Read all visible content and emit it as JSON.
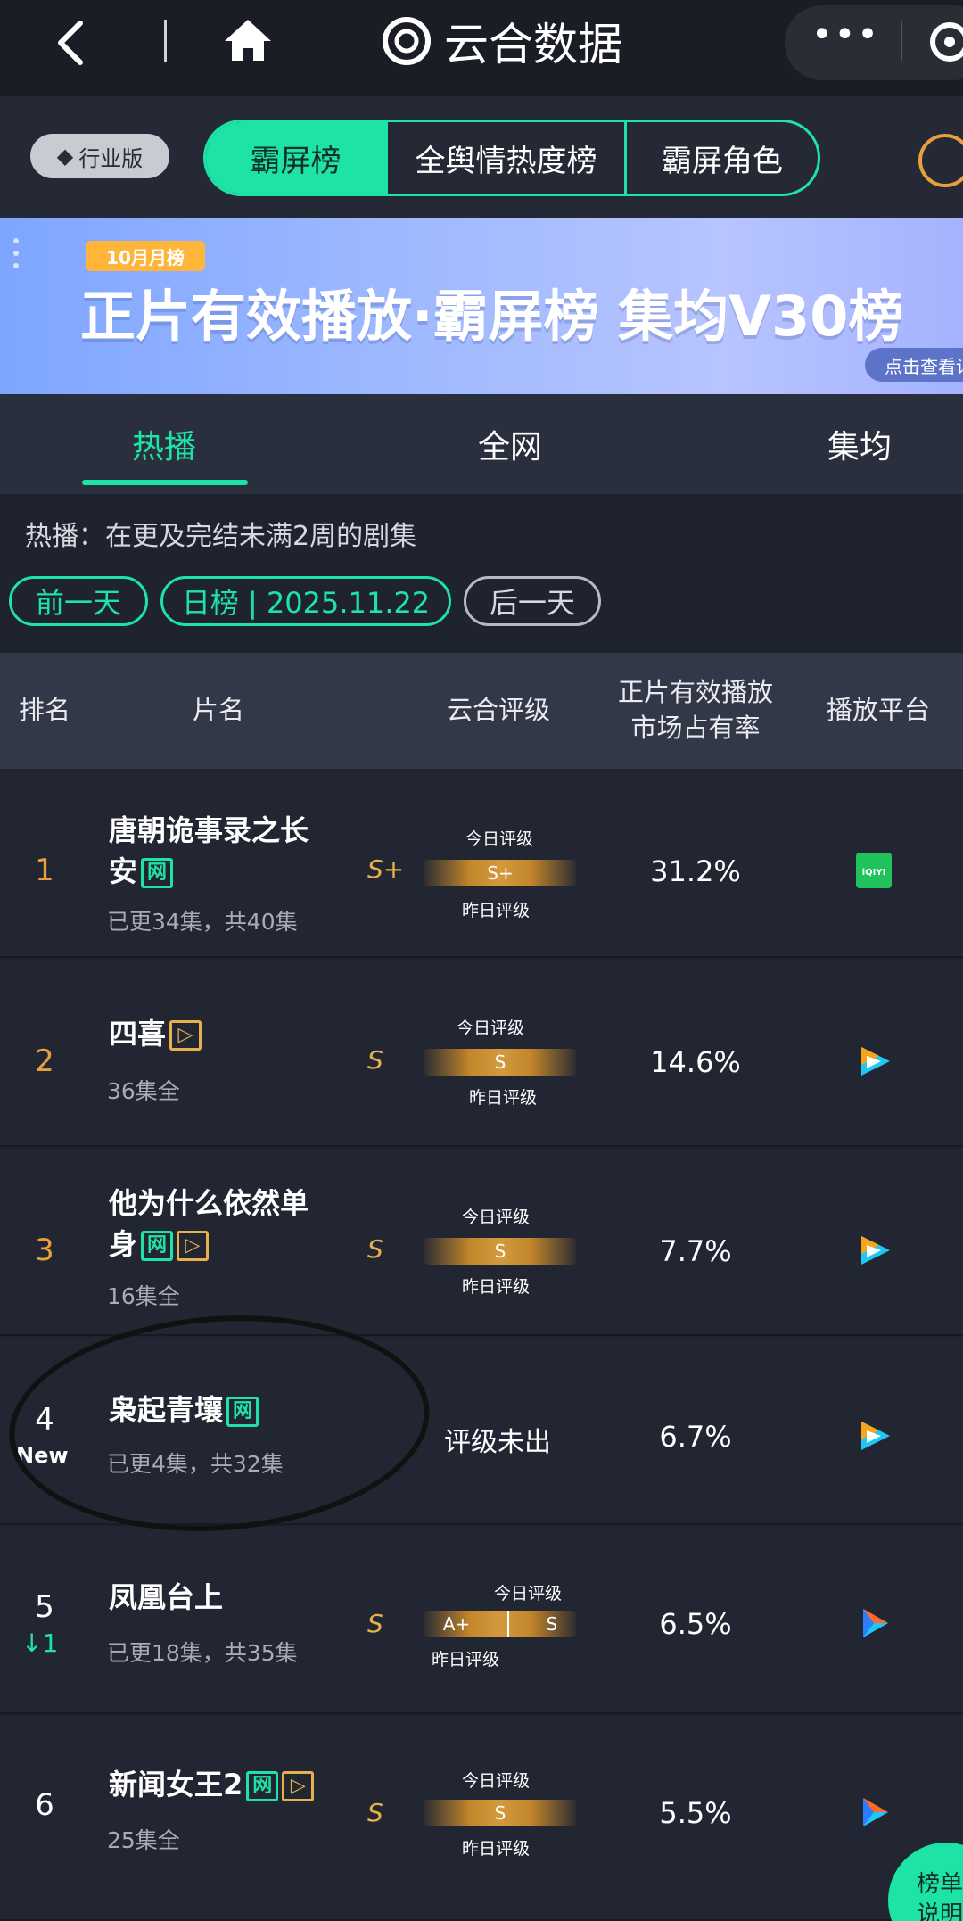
{
  "nav": {
    "back_icon": "chevron-left-icon",
    "home_icon": "home-icon",
    "brand_name": "云合数据",
    "more_dots": "•••"
  },
  "category": {
    "industry_badge": "行业版",
    "segments": [
      "霸屏榜",
      "全舆情热度榜",
      "霸屏角色"
    ],
    "active_segment": 0
  },
  "banner": {
    "tag": "10月月榜",
    "headline": "正片有效播放·霸屏榜 集均V30榜",
    "more": "点击查看详"
  },
  "tabs": {
    "items": [
      "热播",
      "全网",
      "集均"
    ],
    "active": 0
  },
  "hint": "热播：在更及完结未满2周的剧集",
  "date_nav": {
    "prev": "前一天",
    "current": "日榜 | 2025.11.22",
    "next": "后一天"
  },
  "table_header": {
    "rank": "排名",
    "title": "片名",
    "rating": "云合评级",
    "share": "正片有效播放\n市场占有率",
    "platform": "播放平台"
  },
  "rating_labels": {
    "today": "今日评级",
    "yesterday": "昨日评级",
    "not_out": "评级未出"
  },
  "rows": [
    {
      "rank": "1",
      "title_l1": "唐朝诡事录之长",
      "title_l2": "安",
      "tags": [
        "网"
      ],
      "sub": "已更34集，共40集",
      "grade": "S+",
      "bar": "S+",
      "share": "31.2%",
      "platform": "iqiyi-icon"
    },
    {
      "rank": "2",
      "title_l1": "四喜",
      "title_l2": "",
      "tags": [
        "▷"
      ],
      "sub": "36集全",
      "grade": "S",
      "bar": "S",
      "share": "14.6%",
      "platform": "tencent-video-icon"
    },
    {
      "rank": "3",
      "title_l1": "他为什么依然单",
      "title_l2": "身",
      "tags": [
        "网",
        "▷"
      ],
      "sub": "16集全",
      "grade": "S",
      "bar": "S",
      "share": "7.7%",
      "platform": "tencent-video-icon"
    },
    {
      "rank": "4",
      "badge": "New",
      "title_l1": "枭起青壤",
      "title_l2": "",
      "tags": [
        "网"
      ],
      "sub": "已更4集，共32集",
      "grade": "",
      "bar": "",
      "share": "6.7%",
      "platform": "tencent-video-icon"
    },
    {
      "rank": "5",
      "change": "↓1",
      "title_l1": "凤凰台上",
      "title_l2": "",
      "tags": [],
      "sub": "已更18集，共35集",
      "grade": "S",
      "bar_left": "A+",
      "bar_right": "S",
      "share": "6.5%",
      "platform": "youku-icon"
    },
    {
      "rank": "6",
      "title_l1": "新闻女王2",
      "title_l2": "",
      "tags": [
        "网",
        "▷"
      ],
      "sub": "25集全",
      "grade": "S",
      "bar": "S",
      "share": "5.5%",
      "platform": "youku-icon"
    }
  ],
  "float_button": {
    "line1": "榜单",
    "line2": "说明"
  },
  "colors": {
    "accent": "#1ee3a6",
    "gold": "#e7b04b",
    "bg": "#222633"
  }
}
